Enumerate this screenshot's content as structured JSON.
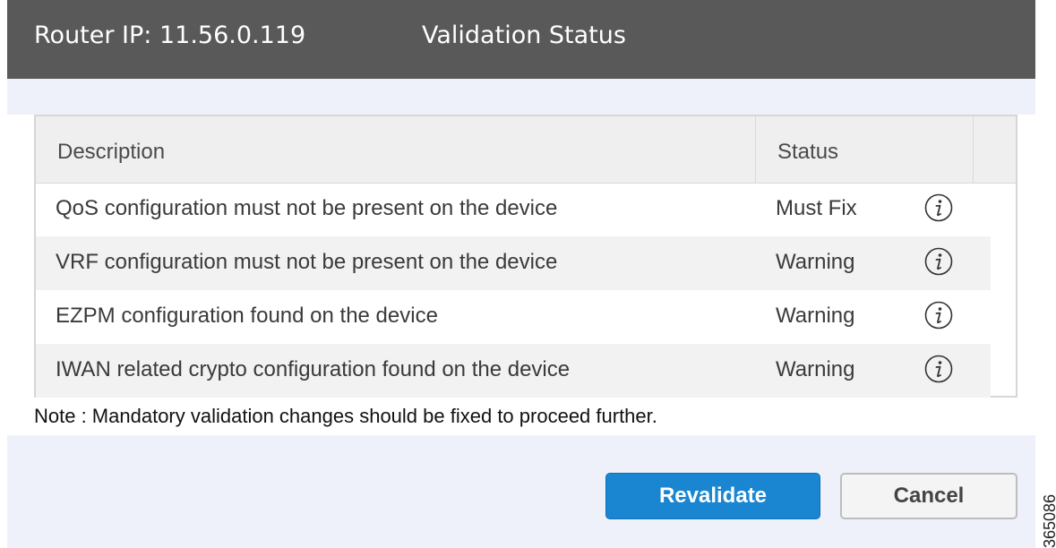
{
  "header": {
    "router_ip": "Router IP: 11.56.0.119",
    "title": "Validation Status"
  },
  "table": {
    "columns": [
      "Description",
      "Status"
    ],
    "rows": [
      {
        "description": "QoS configuration must not be present on the device",
        "status": "Must Fix",
        "icon": "info-icon"
      },
      {
        "description": "VRF configuration must not be present on the device",
        "status": "Warning",
        "icon": "info-icon"
      },
      {
        "description": "EZPM configuration found on the device",
        "status": "Warning",
        "icon": "info-icon"
      },
      {
        "description": "IWAN related crypto configuration found on the device",
        "status": "Warning",
        "icon": "info-icon"
      }
    ]
  },
  "note": "Note : Mandatory validation changes should be fixed to proceed further.",
  "buttons": {
    "revalidate": "Revalidate",
    "cancel": "Cancel"
  },
  "figure_id": "365086",
  "colors": {
    "header_bg": "#595959",
    "primary_button": "#1a86d2",
    "dialog_bg": "#eef1fa"
  }
}
